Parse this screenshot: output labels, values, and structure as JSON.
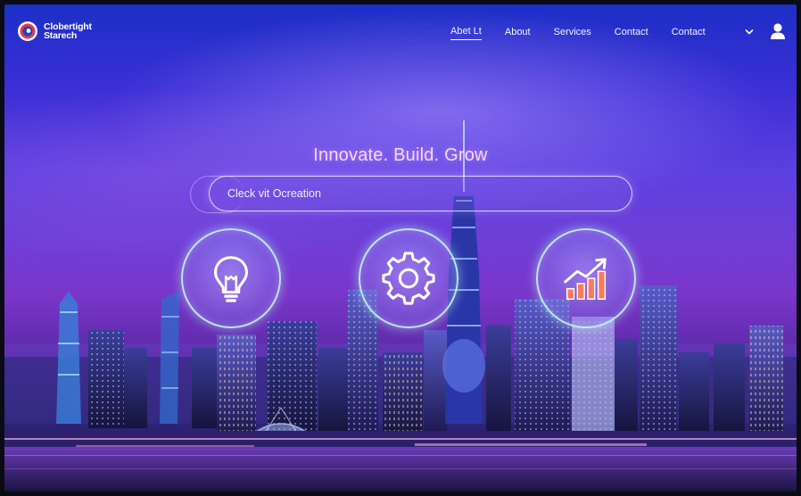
{
  "brand": {
    "line1": "Clobertight",
    "line2": "Starech",
    "logo_colors": [
      "#e8394a",
      "#1e40c9",
      "#ffffff"
    ]
  },
  "nav": {
    "items": [
      {
        "label": "Abet Lt",
        "active": true
      },
      {
        "label": "About",
        "active": false
      },
      {
        "label": "Services",
        "active": false
      },
      {
        "label": "Contact",
        "active": false
      },
      {
        "label": "Contact",
        "active": false
      }
    ]
  },
  "hero": {
    "title": "Innovate. Build. Grow",
    "search_value": "Cleck vit Ocreation"
  },
  "features": [
    {
      "icon": "lightbulb-icon"
    },
    {
      "icon": "gear-icon"
    },
    {
      "icon": "growth-chart-icon"
    }
  ],
  "colors": {
    "accent_glow": "#c8fff0",
    "chart_bars": "#ff7a5c",
    "title": "#f6d9ff"
  }
}
